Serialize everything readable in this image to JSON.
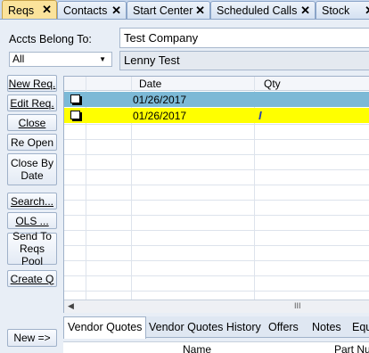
{
  "tabs": [
    {
      "label": "Reqs",
      "active": true
    },
    {
      "label": "Contacts",
      "active": false
    },
    {
      "label": "Start Center",
      "active": false
    },
    {
      "label": "Scheduled Calls",
      "active": false
    },
    {
      "label": "Stock",
      "active": false
    }
  ],
  "tab_close_glyph": "✕",
  "accounts": {
    "label": "Accts Belong To:",
    "selected": "All",
    "company": "Test Company",
    "owner": "Lenny Test"
  },
  "buttons": {
    "new_req": "New Req.",
    "edit_req": "Edit Req.",
    "close": "Close",
    "reopen": "Re Open",
    "close_by_date": [
      "Close By",
      "Date"
    ],
    "search": "Search...",
    "ols": "OLS ...",
    "send_to_pool": [
      "Send To",
      "Reqs Pool"
    ],
    "create_q": "Create Q",
    "new": "New =>"
  },
  "grid": {
    "columns": [
      "Date",
      "Qty"
    ],
    "rows": [
      {
        "date": "01/26/2017",
        "qty": "",
        "highlight": "#7cb9d6"
      },
      {
        "date": "01/26/2017",
        "qty": "",
        "highlight": "#ffff00"
      }
    ],
    "scroll_thumb": "III"
  },
  "subtabs": [
    "Vendor Quotes",
    "Vendor Quotes History",
    "Offers",
    "Notes",
    "Equ"
  ],
  "bottom_grid_columns": [
    "Name",
    "Part Nu"
  ],
  "colors": {
    "active_tab": "#fbe39b",
    "row_selected": "#7cb9d6",
    "row_highlight": "#ffff00"
  }
}
